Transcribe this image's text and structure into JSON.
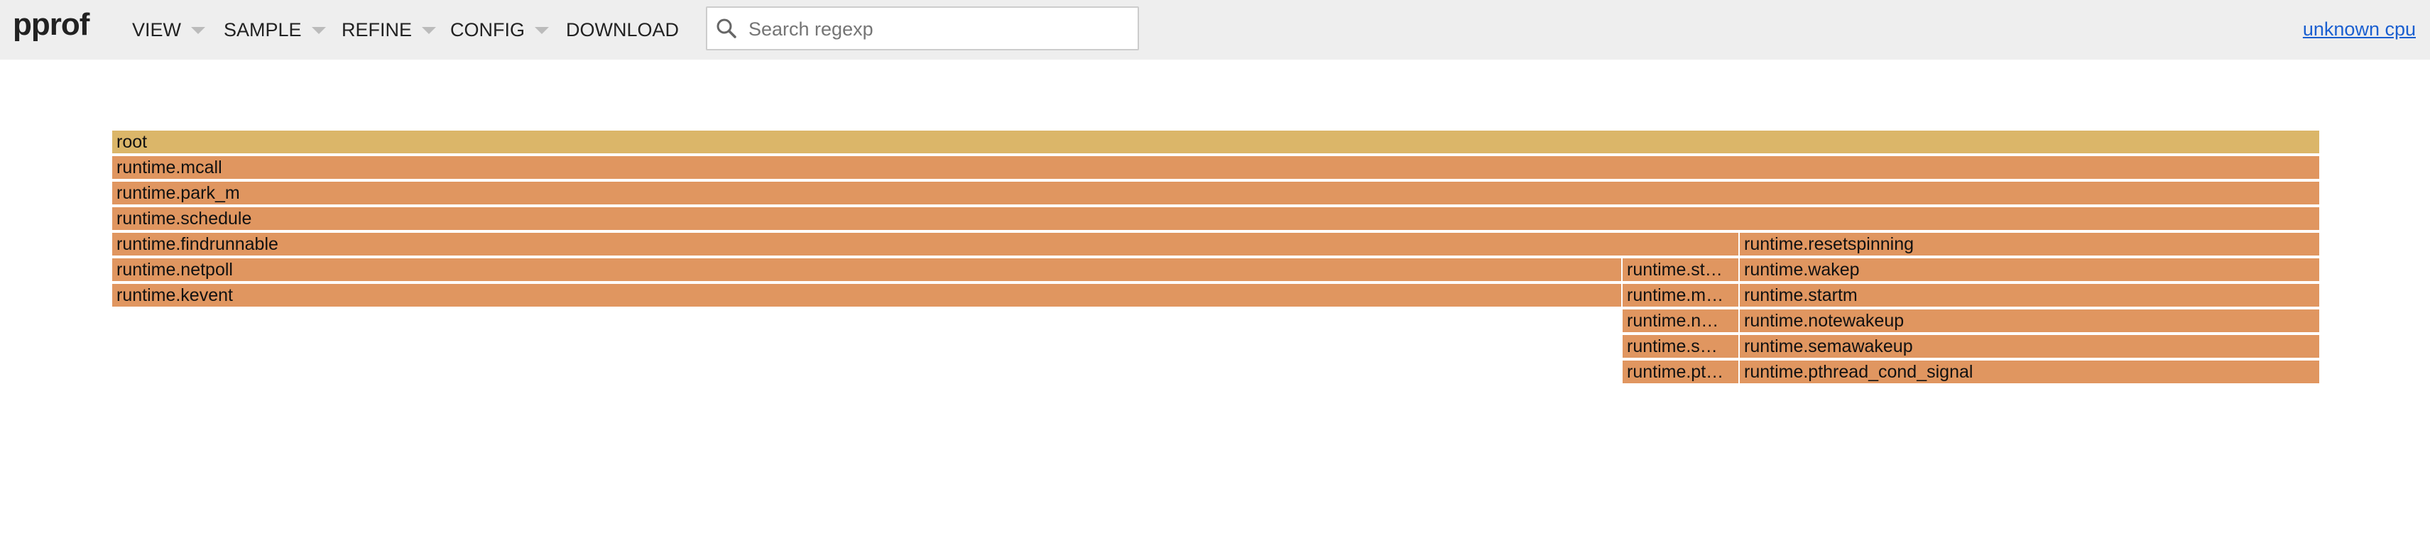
{
  "app": {
    "brand": "pprof"
  },
  "menu": {
    "view": "VIEW",
    "sample": "SAMPLE",
    "refine": "REFINE",
    "config": "CONFIG",
    "download": "DOWNLOAD"
  },
  "search": {
    "placeholder": "Search regexp",
    "value": ""
  },
  "profile_label": "unknown cpu",
  "colors": {
    "topbar": "#eeeeee",
    "root_frame": "#dbb669",
    "frame": "#e09660",
    "link": "#1a5fd0"
  },
  "flamegraph": {
    "frames": [
      {
        "name": "root",
        "depth": 0,
        "start": 0.0,
        "end": 1.0,
        "root": true
      },
      {
        "name": "runtime.mcall",
        "depth": 1,
        "start": 0.0,
        "end": 1.0
      },
      {
        "name": "runtime.park_m",
        "depth": 2,
        "start": 0.0,
        "end": 1.0
      },
      {
        "name": "runtime.schedule",
        "depth": 3,
        "start": 0.0,
        "end": 1.0
      },
      {
        "name": "runtime.findrunnable",
        "depth": 4,
        "start": 0.0,
        "end": 0.737
      },
      {
        "name": "runtime.resetspinning",
        "depth": 4,
        "start": 0.737,
        "end": 1.0
      },
      {
        "name": "runtime.netpoll",
        "depth": 5,
        "start": 0.0,
        "end": 0.684
      },
      {
        "name": "runtime.stopm",
        "display": "runtime.st…",
        "depth": 5,
        "start": 0.684,
        "end": 0.737
      },
      {
        "name": "runtime.wakep",
        "depth": 5,
        "start": 0.737,
        "end": 1.0
      },
      {
        "name": "runtime.kevent",
        "depth": 6,
        "start": 0.0,
        "end": 0.684
      },
      {
        "name": "runtime.mPark",
        "display": "runtime.m…",
        "depth": 6,
        "start": 0.684,
        "end": 0.737
      },
      {
        "name": "runtime.startm",
        "depth": 6,
        "start": 0.737,
        "end": 1.0
      },
      {
        "name": "runtime.notesleep",
        "display": "runtime.n…",
        "depth": 7,
        "start": 0.684,
        "end": 0.737
      },
      {
        "name": "runtime.notewakeup",
        "depth": 7,
        "start": 0.737,
        "end": 1.0
      },
      {
        "name": "runtime.semasleep",
        "display": "runtime.s…",
        "depth": 8,
        "start": 0.684,
        "end": 0.737
      },
      {
        "name": "runtime.semawakeup",
        "depth": 8,
        "start": 0.737,
        "end": 1.0
      },
      {
        "name": "runtime.pthread_cond_wait",
        "display": "runtime.pt…",
        "depth": 9,
        "start": 0.684,
        "end": 0.737
      },
      {
        "name": "runtime.pthread_cond_signal",
        "depth": 9,
        "start": 0.737,
        "end": 1.0
      }
    ]
  }
}
